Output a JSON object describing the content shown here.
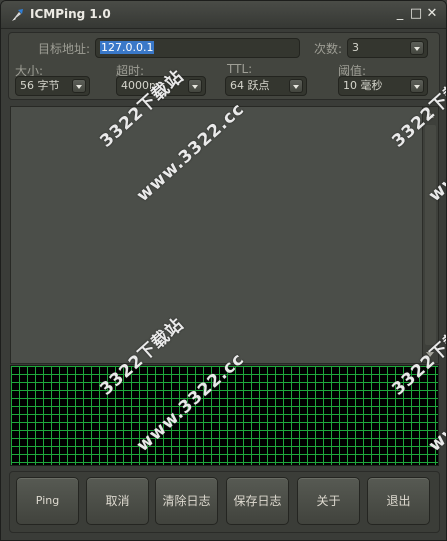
{
  "window": {
    "title": "ICMPing 1.0",
    "controls": {
      "minimize": "_",
      "maximize": "□",
      "close": "✕"
    }
  },
  "settings": {
    "target_label": "目标地址:",
    "target_value": "127.0.0.1",
    "count_label": "次数:",
    "count_value": "3",
    "size_label": "大小:",
    "size_value": "56 字节",
    "timeout_label": "超时:",
    "timeout_value": "4000ms",
    "ttl_label": "TTL:",
    "ttl_value": "64 跃点",
    "threshold_label": "阈值:",
    "threshold_value": "10 毫秒"
  },
  "buttons": {
    "ping": "Ping",
    "cancel": "取消",
    "clear_log": "清除日志",
    "save_log": "保存日志",
    "about": "关于",
    "exit": "退出"
  },
  "watermark": {
    "site_name": "3322下载站",
    "site_url": "www.3322.cc"
  },
  "colors": {
    "grid_line": "#1ea83b",
    "graph_bg": "#000000",
    "selection": "#3a78c8"
  }
}
